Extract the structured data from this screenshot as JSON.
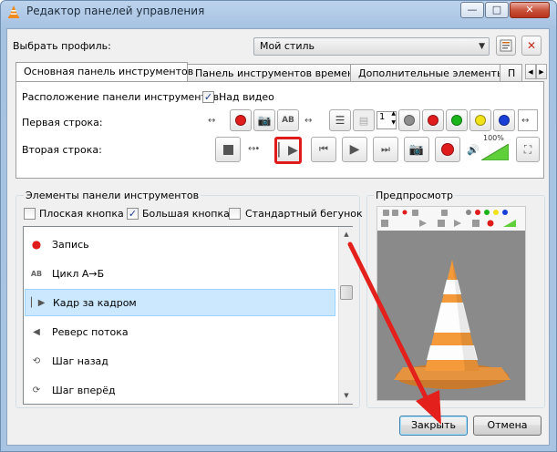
{
  "window": {
    "title": "Редактор панелей управления"
  },
  "profile": {
    "label": "Выбрать профиль:",
    "value": "Мой стиль"
  },
  "tabs": [
    {
      "label": "Основная панель инструментов"
    },
    {
      "label": "Панель инструментов времени"
    },
    {
      "label": "Дополнительные элементы"
    },
    {
      "label": "П"
    }
  ],
  "toolbar_tab": {
    "position_label": "Расположение панели инструментов:",
    "position_checkbox": "Над видео",
    "row1_label": "Первая строка:",
    "row2_label": "Вторая строка:",
    "spin_value": "1",
    "volume_percent": "100%"
  },
  "elements_panel": {
    "title": "Элементы панели инструментов",
    "options": [
      {
        "label": "Плоская кнопка",
        "checked": false
      },
      {
        "label": "Большая кнопка",
        "checked": true
      },
      {
        "label": "Стандартный бегунок",
        "checked": false
      }
    ],
    "items": [
      {
        "label": "Запись"
      },
      {
        "label": "Цикл А→Б"
      },
      {
        "label": "Кадр за кадром"
      },
      {
        "label": "Реверс потока"
      },
      {
        "label": "Шаг назад"
      },
      {
        "label": "Шаг вперёд"
      }
    ]
  },
  "preview": {
    "title": "Предпросмотр"
  },
  "buttons": {
    "close": "Закрыть",
    "cancel": "Отмена"
  },
  "colors": {
    "highlight": "#e01b1b",
    "accent_selection": "#cce8ff",
    "arrow": "#e3201b"
  }
}
